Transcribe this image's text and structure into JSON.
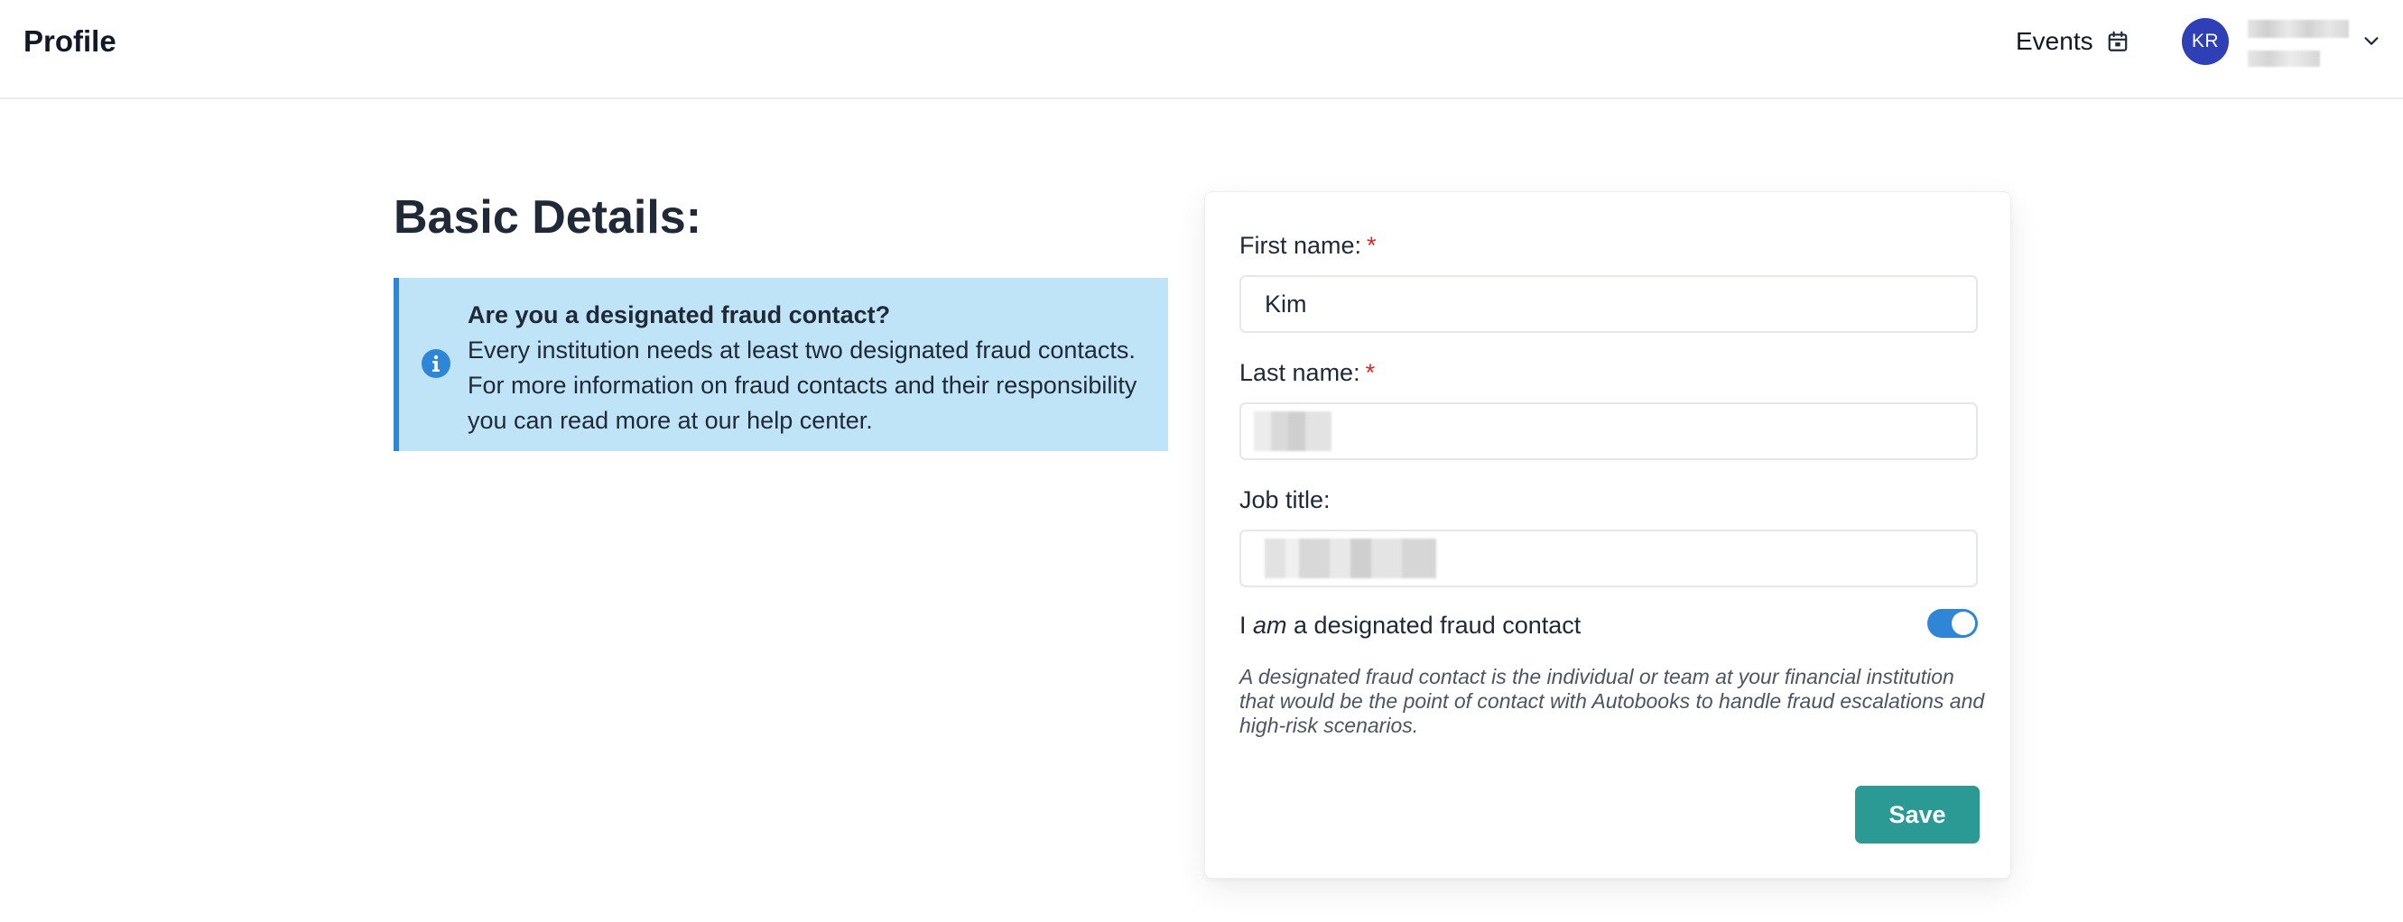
{
  "header": {
    "title": "Profile",
    "events_label": "Events",
    "events_icon": "calendar-icon",
    "user": {
      "initials": "KR",
      "avatar_color": "#2f3fb5",
      "menu_icon": "chevron-down-icon"
    }
  },
  "main": {
    "heading": "Basic Details:",
    "info": {
      "icon": "info-icon",
      "title": "Are you a designated fraud contact?",
      "body": "Every institution needs at least two designated fraud contacts. For more information on fraud contacts and their responsibility you can read more at our help center.",
      "background": "#bfe3f7",
      "accent": "#2f86d6"
    }
  },
  "form": {
    "first_name": {
      "label": "First name:",
      "required_mark": "*",
      "value": "Kim"
    },
    "last_name": {
      "label": "Last name:",
      "required_mark": "*",
      "value": ""
    },
    "job_title": {
      "label": "Job title:",
      "value": ""
    },
    "fraud_contact": {
      "label_prefix": "I ",
      "label_em": "am",
      "label_suffix": " a designated fraud contact",
      "enabled": true,
      "helper": "A designated fraud contact is the individual or team at your financial institution that would be the point of contact with Autobooks to handle fraud escalations and high-risk scenarios."
    },
    "save_label": "Save",
    "save_color": "#2b9a94"
  }
}
